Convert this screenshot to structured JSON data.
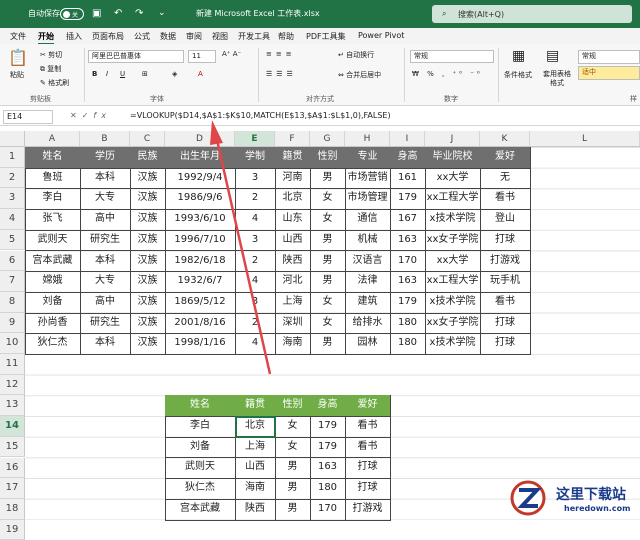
{
  "titlebar": {
    "autosave_label": "自动保存",
    "toggle_state": "关",
    "filename": "新建 Microsoft Excel 工作表.xlsx",
    "search_placeholder": "搜索(Alt+Q)"
  },
  "menus": [
    "文件",
    "开始",
    "插入",
    "页面布局",
    "公式",
    "数据",
    "审阅",
    "视图",
    "开发工具",
    "帮助",
    "PDF工具集",
    "Power Pivot"
  ],
  "ribbon": {
    "paste": "粘贴",
    "cut": "剪切",
    "copy": "复制",
    "format_painter": "格式刷",
    "clipboard": "剪贴板",
    "font_name": "阿里巴巴普惠体",
    "font_size": "11",
    "font_group": "字体",
    "wrap": "自动换行",
    "merge": "合并后居中",
    "align_group": "对齐方式",
    "number_format": "常规",
    "number_group": "数字",
    "cond_format": "条件格式",
    "table_format": "套用表格格式",
    "style_normal": "常规",
    "style_mid": "适中",
    "style_group": "样"
  },
  "formula_bar": {
    "name_box": "E14",
    "formula": "=VLOOKUP($D14,$A$1:$K$10,MATCH(E$13,$A$1:$L$1,0),FALSE)"
  },
  "columns": [
    "A",
    "B",
    "C",
    "D",
    "E",
    "F",
    "G",
    "H",
    "I",
    "J",
    "K",
    "L"
  ],
  "rows": [
    "1",
    "2",
    "3",
    "4",
    "5",
    "6",
    "7",
    "8",
    "9",
    "10",
    "11",
    "12",
    "13",
    "14",
    "15",
    "16",
    "17",
    "18",
    "19"
  ],
  "main_table": {
    "headers": [
      "姓名",
      "学历",
      "民族",
      "出生年月",
      "学制",
      "籍贯",
      "性别",
      "专业",
      "身高",
      "毕业院校",
      "爱好"
    ],
    "rows": [
      [
        "鲁班",
        "本科",
        "汉族",
        "1992/9/4",
        "3",
        "河南",
        "男",
        "市场营销",
        "161",
        "xx大学",
        "无"
      ],
      [
        "李白",
        "大专",
        "汉族",
        "1986/9/6",
        "2",
        "北京",
        "女",
        "市场管理",
        "179",
        "xx工程大学",
        "看书"
      ],
      [
        "张飞",
        "高中",
        "汉族",
        "1993/6/10",
        "4",
        "山东",
        "女",
        "通信",
        "167",
        "x技术学院",
        "登山"
      ],
      [
        "武则天",
        "研究生",
        "汉族",
        "1996/7/10",
        "3",
        "山西",
        "男",
        "机械",
        "163",
        "xx女子学院",
        "打球"
      ],
      [
        "宫本武藏",
        "本科",
        "汉族",
        "1982/6/18",
        "2",
        "陕西",
        "男",
        "汉语言",
        "170",
        "xx大学",
        "打游戏"
      ],
      [
        "嫦娥",
        "大专",
        "汉族",
        "1932/6/7",
        "4",
        "河北",
        "男",
        "法律",
        "163",
        "xx工程大学",
        "玩手机"
      ],
      [
        "刘备",
        "高中",
        "汉族",
        "1869/5/12",
        "3",
        "上海",
        "女",
        "建筑",
        "179",
        "x技术学院",
        "看书"
      ],
      [
        "孙尚香",
        "研究生",
        "汉族",
        "2001/8/16",
        "2",
        "深圳",
        "女",
        "给排水",
        "180",
        "xx女子学院",
        "打球"
      ],
      [
        "狄仁杰",
        "本科",
        "汉族",
        "1998/1/16",
        "4",
        "海南",
        "男",
        "园林",
        "180",
        "x技术学院",
        "打球"
      ]
    ]
  },
  "lookup_table": {
    "headers": [
      "姓名",
      "籍贯",
      "性别",
      "身高",
      "爱好"
    ],
    "rows": [
      [
        "李白",
        "北京",
        "女",
        "179",
        "看书"
      ],
      [
        "刘备",
        "上海",
        "女",
        "179",
        "看书"
      ],
      [
        "武则天",
        "山西",
        "男",
        "163",
        "打球"
      ],
      [
        "狄仁杰",
        "海南",
        "男",
        "180",
        "打球"
      ],
      [
        "宫本武藏",
        "陕西",
        "男",
        "170",
        "打游戏"
      ]
    ]
  },
  "watermark": {
    "text": "这里下载站",
    "url": "heredown.com"
  },
  "colors": {
    "excel_green": "#217346",
    "header_gray": "#6f6f6f",
    "header_green": "#70ad47",
    "arrow_red": "#e0454a"
  }
}
